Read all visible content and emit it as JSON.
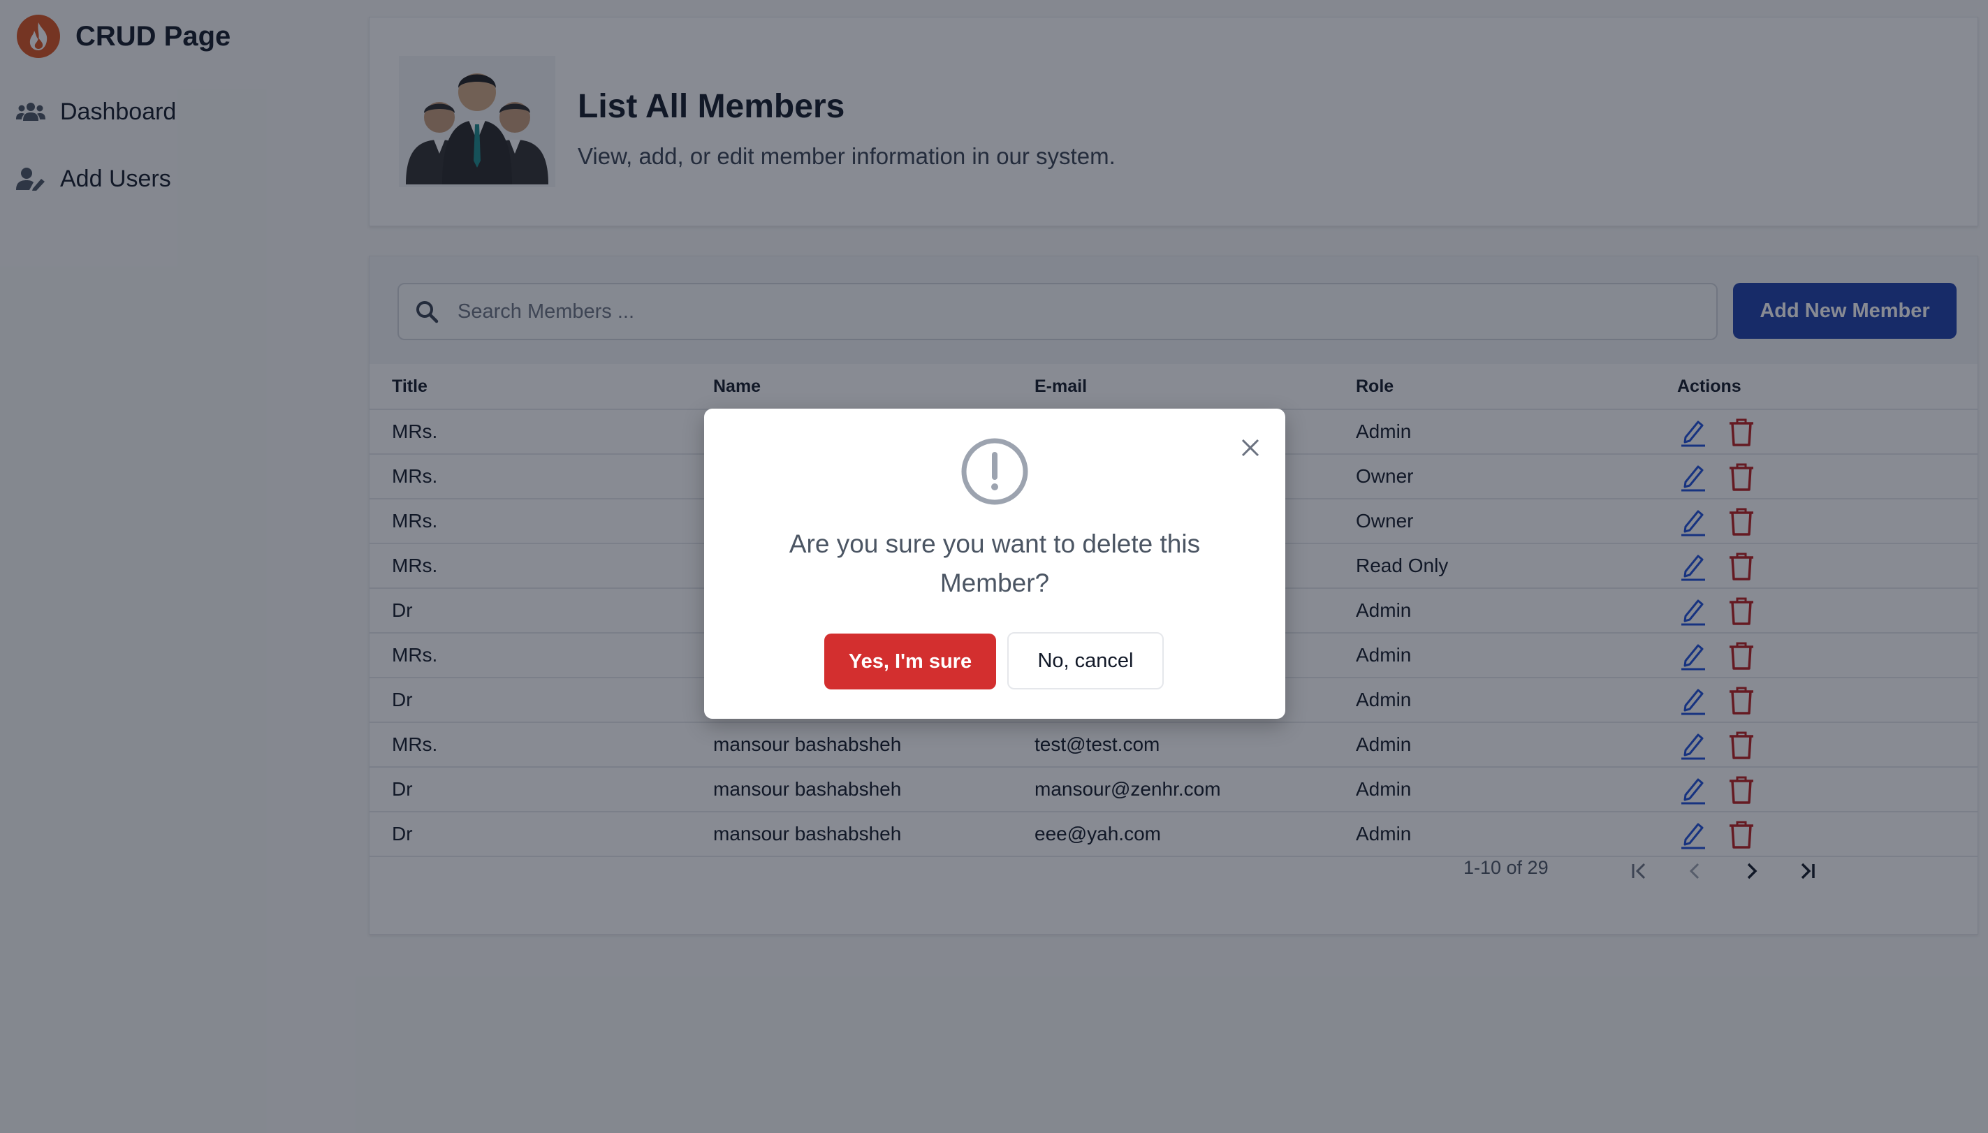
{
  "app": {
    "title": "CRUD Page"
  },
  "sidebar": {
    "items": [
      {
        "label": "Dashboard",
        "icon": "users-icon"
      },
      {
        "label": "Add Users",
        "icon": "user-edit-icon"
      }
    ]
  },
  "header": {
    "title": "List All Members",
    "subtitle": "View, add, or edit member information in our system."
  },
  "toolbar": {
    "search_placeholder": "Search Members ...",
    "add_label": "Add New Member"
  },
  "table": {
    "columns": [
      "Title",
      "Name",
      "E-mail",
      "Role",
      "Actions"
    ],
    "rows": [
      {
        "title": "MRs.",
        "name": "",
        "email": "",
        "role": "Admin"
      },
      {
        "title": "MRs.",
        "name": "",
        "email": "",
        "role": "Owner"
      },
      {
        "title": "MRs.",
        "name": "",
        "email": "",
        "role": "Owner"
      },
      {
        "title": "MRs.",
        "name": "",
        "email": "",
        "role": "Read Only"
      },
      {
        "title": "Dr",
        "name": "",
        "email": "",
        "role": "Admin"
      },
      {
        "title": "MRs.",
        "name": "",
        "email": "",
        "role": "Admin"
      },
      {
        "title": "Dr",
        "name": "",
        "email": "",
        "role": "Admin"
      },
      {
        "title": "MRs.",
        "name": "mansour bashabsheh",
        "email": "test@test.com",
        "role": "Admin"
      },
      {
        "title": "Dr",
        "name": "mansour bashabsheh",
        "email": "mansour@zenhr.com",
        "role": "Admin"
      },
      {
        "title": "Dr",
        "name": "mansour bashabsheh",
        "email": "eee@yah.com",
        "role": "Admin"
      }
    ]
  },
  "pagination": {
    "range_text": "1-10 of 29"
  },
  "modal": {
    "message": "Are you sure you want to delete this Member?",
    "confirm_label": "Yes, I'm sure",
    "cancel_label": "No, cancel"
  },
  "colors": {
    "primary": "#1d3fa8",
    "danger": "#d32f2f",
    "edit_icon": "#1d4ed8",
    "delete_icon": "#b91c1c",
    "brand": "#d9531e"
  }
}
